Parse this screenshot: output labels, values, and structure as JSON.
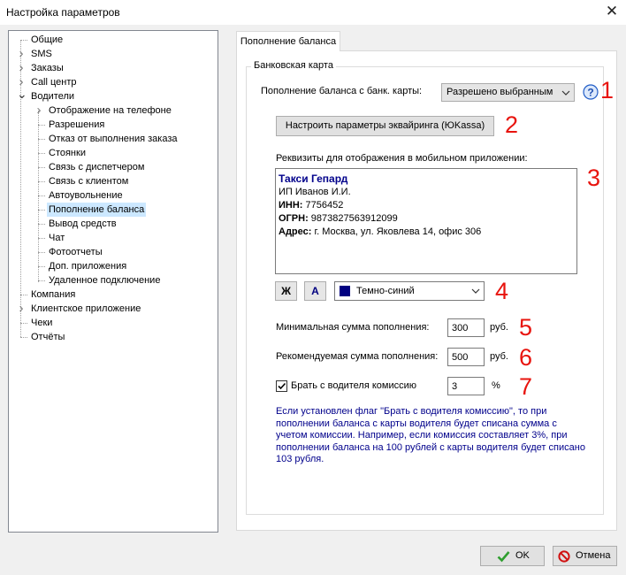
{
  "window": {
    "title": "Настройка параметров",
    "close_label": "✕"
  },
  "tree": {
    "items": [
      {
        "label": "Общие",
        "level": 0,
        "expander": "",
        "selected": false
      },
      {
        "label": "SMS",
        "level": 0,
        "expander": ">",
        "selected": false
      },
      {
        "label": "Заказы",
        "level": 0,
        "expander": ">",
        "selected": false
      },
      {
        "label": "Call центр",
        "level": 0,
        "expander": ">",
        "selected": false
      },
      {
        "label": "Водители",
        "level": 0,
        "expander": "v",
        "selected": false
      },
      {
        "label": "Отображение на телефоне",
        "level": 1,
        "expander": ">",
        "selected": false
      },
      {
        "label": "Разрешения",
        "level": 1,
        "expander": "",
        "selected": false
      },
      {
        "label": "Отказ от выполнения заказа",
        "level": 1,
        "expander": "",
        "selected": false
      },
      {
        "label": "Стоянки",
        "level": 1,
        "expander": "",
        "selected": false
      },
      {
        "label": "Связь с диспетчером",
        "level": 1,
        "expander": "",
        "selected": false
      },
      {
        "label": "Связь с клиентом",
        "level": 1,
        "expander": "",
        "selected": false
      },
      {
        "label": "Автоувольнение",
        "level": 1,
        "expander": "",
        "selected": false
      },
      {
        "label": "Пополнение баланса",
        "level": 1,
        "expander": "",
        "selected": true
      },
      {
        "label": "Вывод средств",
        "level": 1,
        "expander": "",
        "selected": false
      },
      {
        "label": "Чат",
        "level": 1,
        "expander": "",
        "selected": false
      },
      {
        "label": "Фотоотчеты",
        "level": 1,
        "expander": "",
        "selected": false
      },
      {
        "label": "Доп. приложения",
        "level": 1,
        "expander": "",
        "selected": false
      },
      {
        "label": "Удаленное подключение",
        "level": 1,
        "expander": "",
        "selected": false
      },
      {
        "label": "Компания",
        "level": 0,
        "expander": "",
        "selected": false
      },
      {
        "label": "Клиентское приложение",
        "level": 0,
        "expander": ">",
        "selected": false
      },
      {
        "label": "Чеки",
        "level": 0,
        "expander": "",
        "selected": false
      },
      {
        "label": "Отчёты",
        "level": 0,
        "expander": "",
        "selected": false
      }
    ]
  },
  "tab": {
    "label": "Пополнение баланса"
  },
  "group": {
    "legend": "Банковская карта"
  },
  "card_topup": {
    "label": "Пополнение баланса с банк. карты:",
    "value": "Разрешено выбранным"
  },
  "acquiring_button": "Настроить параметры эквайринга (ЮKassa)",
  "requisites": {
    "label": "Реквизиты для отображения в мобильном приложении:",
    "company": "Такси Гепард",
    "owner": "ИП Иванов И.И.",
    "inn_label": "ИНН:",
    "inn_value": " 7756452",
    "ogrn_label": "ОГРН:",
    "ogrn_value": " 9873827563912099",
    "address_label": "Адрес:",
    "address_value": " г. Москва, ул. Яковлева 14, офис 306"
  },
  "format": {
    "bold_button": "Ж",
    "color_button": "А",
    "color_name": "Темно-синий",
    "color_swatch": "#000080"
  },
  "min_sum": {
    "label": "Минимальная сумма пополнения:",
    "value": "300",
    "unit": "руб."
  },
  "rec_sum": {
    "label": "Рекомендуемая сумма пополнения:",
    "value": "500",
    "unit": "руб."
  },
  "commission": {
    "label": "Брать с водителя комиссию",
    "checked": true,
    "value": "3",
    "unit": "%"
  },
  "note": "Если установлен флаг \"Брать с водителя комиссию\", то при пополнении баланса с карты водителя будет списана сумма с учетом комиссии. Например, если комиссия составляет 3%, при пополнении баланса на 100 рублей с карты водителя будет списано 103 рубля.",
  "annotations": [
    "1",
    "2",
    "3",
    "4",
    "5",
    "6",
    "7"
  ],
  "footer": {
    "ok_label": "OK",
    "cancel_label": "Отмена"
  },
  "icons": {
    "help": "help-icon",
    "ok": "checkmark-icon",
    "cancel": "no-entry-icon"
  }
}
